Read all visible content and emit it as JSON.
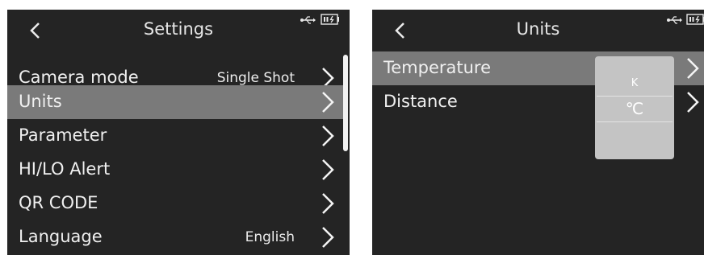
{
  "settings_screen": {
    "title": "Settings",
    "back_icon": "chevron-left-icon",
    "status": {
      "usb_icon": "usb-icon",
      "battery_icon": "battery-charging-icon"
    },
    "items": [
      {
        "label": "Camera mode",
        "value": "Single Shot",
        "selected": false
      },
      {
        "label": "Units",
        "value": "",
        "selected": true
      },
      {
        "label": "Parameter",
        "value": "",
        "selected": false
      },
      {
        "label": "HI/LO Alert",
        "value": "",
        "selected": false
      },
      {
        "label": "QR CODE",
        "value": "",
        "selected": false
      },
      {
        "label": "Language",
        "value": "English",
        "selected": false
      }
    ]
  },
  "units_screen": {
    "title": "Units",
    "back_icon": "chevron-left-icon",
    "status": {
      "usb_icon": "usb-icon",
      "battery_icon": "battery-charging-icon"
    },
    "items": [
      {
        "label": "Temperature",
        "selected": true
      },
      {
        "label": "Distance",
        "selected": false
      }
    ],
    "popup": {
      "options": [
        "K",
        "℃"
      ],
      "selected": "℃"
    }
  },
  "colors": {
    "screen_bg": "#242424",
    "selected_row": "#7a7a7a",
    "popup_bg": "#c4c4c4",
    "text": "#f0f0f0"
  }
}
